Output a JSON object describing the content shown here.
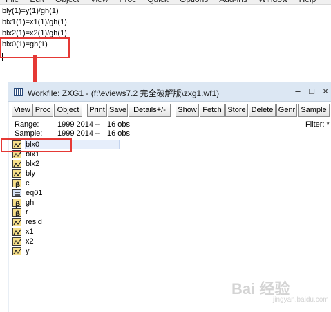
{
  "menu": [
    "File",
    "Edit",
    "Object",
    "View",
    "Proc",
    "Quick",
    "Options",
    "Add-ins",
    "Window",
    "Help"
  ],
  "command": {
    "lines": [
      "bly(1)=y(1)/gh(1)",
      "blx1(1)=x1(1)/gh(1)",
      "blx2(1)=x2(1)/gh(1)",
      "blx0(1)=gh(1)"
    ],
    "highlighted_line": "blx0(1)=gh(1)"
  },
  "workfile": {
    "title": "Workfile: ZXG1 - (f:\\eviews7.2 完全破解版\\zxg1.wf1)",
    "controls": {
      "minimize": "–",
      "maximize": "□",
      "close": "×"
    },
    "toolbar": [
      "View",
      "Proc",
      "Object",
      "Print",
      "Save",
      "Details+/-",
      "Show",
      "Fetch",
      "Store",
      "Delete",
      "Genr",
      "Sample"
    ],
    "range": {
      "label": "Range:",
      "value": "1999 2014",
      "sep": "--",
      "obs": "16 obs"
    },
    "sample": {
      "label": "Sample:",
      "value": "1999 2014",
      "sep": "--",
      "obs": "16 obs"
    },
    "filter": "Filter: *",
    "objects": [
      {
        "name": "blx0",
        "icon": "series-icon",
        "selected": true
      },
      {
        "name": "blx1",
        "icon": "series-icon"
      },
      {
        "name": "blx2",
        "icon": "series-icon"
      },
      {
        "name": "bly",
        "icon": "series-icon"
      },
      {
        "name": "c",
        "icon": "coefficient-icon"
      },
      {
        "name": "eq01",
        "icon": "equation-icon"
      },
      {
        "name": "gh",
        "icon": "coefficient-icon"
      },
      {
        "name": "r",
        "icon": "coefficient-icon"
      },
      {
        "name": "resid",
        "icon": "series-icon"
      },
      {
        "name": "x1",
        "icon": "series-icon"
      },
      {
        "name": "x2",
        "icon": "series-icon"
      },
      {
        "name": "y",
        "icon": "series-icon"
      }
    ]
  },
  "watermark": {
    "main": "Bai 经验",
    "sub": "jingyan.baidu.com"
  },
  "colors": {
    "highlight_red": "#e53935",
    "titlebar": "#dce7f3",
    "series_icon": "#f7e08a"
  }
}
